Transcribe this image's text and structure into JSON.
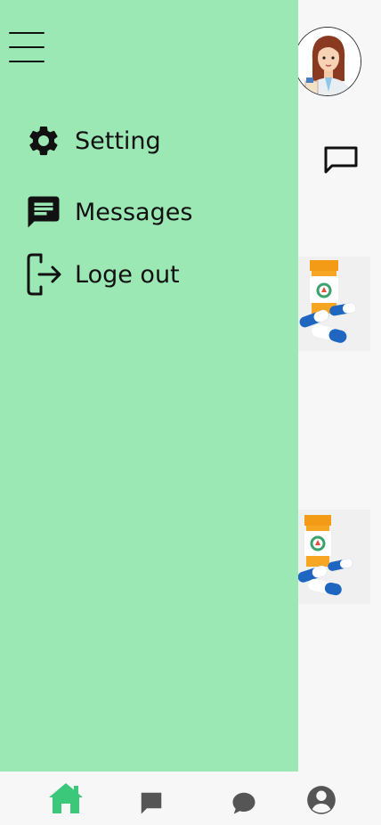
{
  "drawer": {
    "menu_items": [
      {
        "label": "Setting",
        "icon": "gear-icon"
      },
      {
        "label": "Messages",
        "icon": "message-icon"
      },
      {
        "label": "Loge out",
        "icon": "logout-icon"
      }
    ],
    "background_color": "#9be8b5"
  },
  "header": {
    "avatar": "doctor-avatar",
    "chat_icon": "chat-outline-icon"
  },
  "content": {
    "cards": [
      {
        "image": "medicine-bottle-pills"
      },
      {
        "image": "medicine-bottle-pills"
      }
    ]
  },
  "bottom_nav": {
    "items": [
      {
        "icon": "home-icon",
        "active": true
      },
      {
        "icon": "message-square-icon",
        "active": false
      },
      {
        "icon": "chat-bubble-icon",
        "active": false
      },
      {
        "icon": "profile-icon",
        "active": false
      }
    ],
    "active_color": "#3cc87a",
    "inactive_color": "#555555"
  }
}
